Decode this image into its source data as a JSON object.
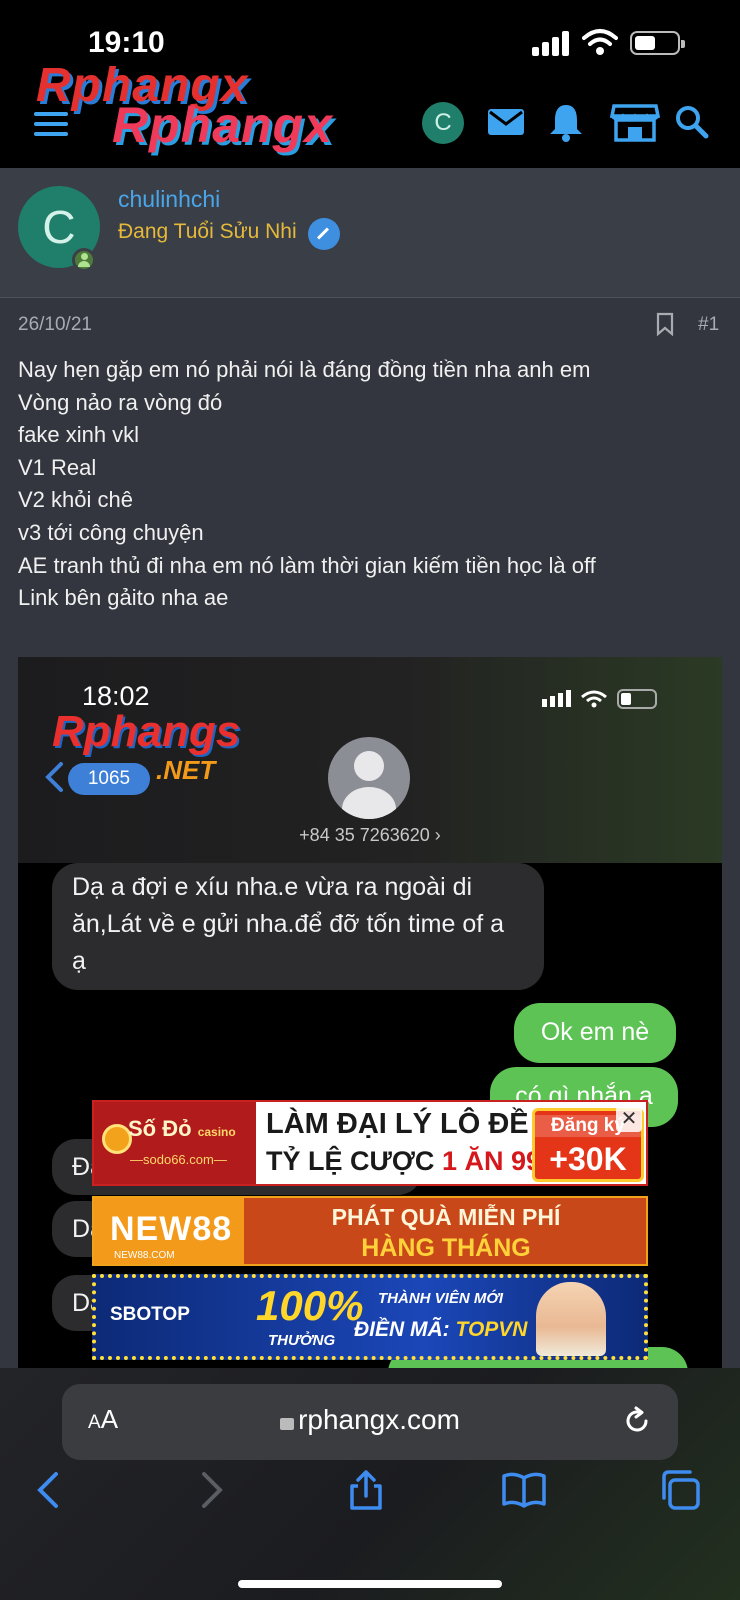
{
  "status_bar": {
    "time": "19:10"
  },
  "site_header": {
    "logo_primary": "Rphangx",
    "logo_secondary": "Rphangx",
    "avatar_letter": "C"
  },
  "post": {
    "author": {
      "avatar_letter": "C",
      "username": "chulinhchi",
      "title": "Đang Tuổi Sửu Nhi"
    },
    "date": "26/10/21",
    "number": "#1",
    "lines": [
      "Nay hẹn gặp em nó phải nói là đáng đồng tiền nha anh em",
      "Vòng nảo ra vòng đó",
      "fake xinh vkl",
      "V1 Real",
      "V2 khỏi chê",
      "v3 tới công chuyện",
      "AE tranh thủ đi nha em nó làm thời gian kiếm tiền học là off",
      "Link bên gảito nha ae"
    ],
    "embedded_screenshot": {
      "time": "18:02",
      "watermark_main": "Rphangs",
      "watermark_sub": ".NET",
      "unread_count": "1065",
      "phone": "+84 35 7263620 ›",
      "msg_incoming": "Dạ a đợi e xíu nha.e vừa ra ngoài di ăn,Lát về e gửi nha.để đỡ tốn time of a ạ",
      "msg_out_1": "Ok em nè",
      "msg_out_2": "có gì nhắn a",
      "msg_partial_1": "Đa yêu thiên - có gì nhắn a",
      "msg_partial_2": "Da",
      "msg_partial_3": "Da"
    }
  },
  "ads": [
    {
      "brand": "Số Đỏ",
      "brand_tag": "casino",
      "domain": "—sodo66.com—",
      "line1": "LÀM ĐẠI LÝ LÔ ĐỀ",
      "line2_prefix": "TỶ LỆ CƯỢC ",
      "line2_highlight": "1 ĂN 99.5",
      "badge_top": "Đăng ký",
      "badge_main": "+30K",
      "close": "✕"
    },
    {
      "brand": "NEW88",
      "domain": "NEW88.COM",
      "line1": "PHÁT QUÀ MIỄN PHÍ",
      "line2": "HÀNG THÁNG"
    },
    {
      "brand": "SBOTOP",
      "percent": "100%",
      "thuong": "THƯỞNG",
      "line1": "THÀNH VIÊN MỚI",
      "line2_prefix": "ĐIỀN MÃ: ",
      "line2_code": "TOPVN"
    }
  ],
  "browser": {
    "text_size_label_small": "A",
    "text_size_label_large": "A",
    "url": "rphangx.com"
  },
  "colors": {
    "accent": "#3fa4f0",
    "username": "#4aa6ea",
    "user_title": "#e5b93a",
    "imessage_green": "#5cc354",
    "post_background": "#33363e"
  }
}
